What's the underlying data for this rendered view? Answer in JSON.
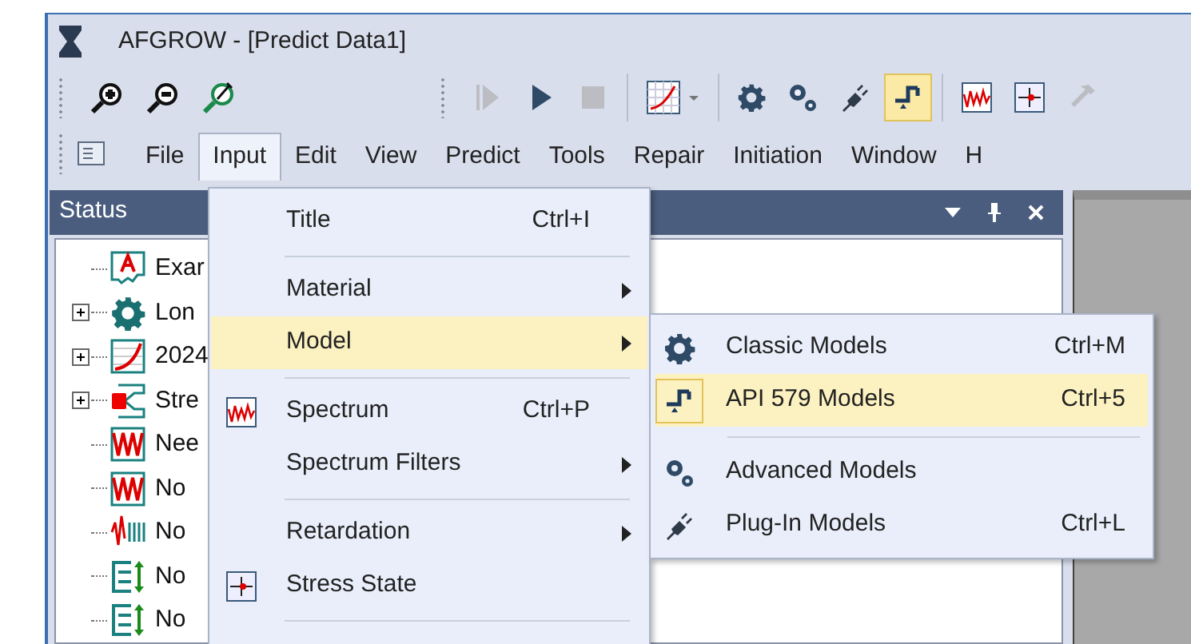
{
  "window": {
    "title": "AFGROW - [Predict Data1]"
  },
  "toolbar": {
    "buttons": [
      {
        "selected": false,
        "disabled": false
      },
      {
        "selected": false,
        "disabled": false
      },
      {
        "selected": false,
        "disabled": false
      },
      {
        "selected": false,
        "disabled": true
      },
      {
        "selected": false,
        "disabled": false
      },
      {
        "selected": false,
        "disabled": true
      },
      {
        "selected": false,
        "disabled": false
      },
      {
        "selected": false,
        "disabled": false
      },
      {
        "selected": false,
        "disabled": false
      },
      {
        "selected": false,
        "disabled": false
      },
      {
        "selected": true,
        "disabled": false
      },
      {
        "selected": false,
        "disabled": false
      },
      {
        "selected": false,
        "disabled": false
      },
      {
        "selected": false,
        "disabled": true
      }
    ]
  },
  "menubar": {
    "items": [
      {
        "label": "File",
        "selected": false
      },
      {
        "label": "Input",
        "selected": true
      },
      {
        "label": "Edit",
        "selected": false
      },
      {
        "label": "View",
        "selected": false
      },
      {
        "label": "Predict",
        "selected": false
      },
      {
        "label": "Tools",
        "selected": false
      },
      {
        "label": "Repair",
        "selected": false
      },
      {
        "label": "Initiation",
        "selected": false
      },
      {
        "label": "Window",
        "selected": false
      },
      {
        "label": "H",
        "selected": false
      }
    ]
  },
  "status_panel": {
    "title": "Status",
    "tree": [
      {
        "label": "Exar",
        "kind": "leaf"
      },
      {
        "label": "Lon",
        "kind": "branch"
      },
      {
        "label": "2024",
        "kind": "branch"
      },
      {
        "label": "Stre",
        "kind": "branch"
      },
      {
        "label": "Nee",
        "kind": "leaf"
      },
      {
        "label": "No",
        "kind": "leaf"
      },
      {
        "label": "No",
        "kind": "leaf"
      },
      {
        "label": "No",
        "kind": "leaf"
      },
      {
        "label": "No",
        "kind": "leaf"
      }
    ]
  },
  "input_menu": {
    "items": [
      {
        "kind": "item",
        "label": "Title",
        "shortcut": "Ctrl+I",
        "submenu": false,
        "selected": false
      },
      {
        "kind": "separator"
      },
      {
        "kind": "item",
        "label": "Material",
        "submenu": true,
        "selected": false
      },
      {
        "kind": "item",
        "label": "Model",
        "submenu": true,
        "selected": true
      },
      {
        "kind": "separator"
      },
      {
        "kind": "item",
        "label": "Spectrum",
        "shortcut": "Ctrl+P",
        "submenu": false,
        "selected": false
      },
      {
        "kind": "item",
        "label": "Spectrum Filters",
        "submenu": true,
        "selected": false
      },
      {
        "kind": "separator"
      },
      {
        "kind": "item",
        "label": "Retardation",
        "submenu": true,
        "selected": false
      },
      {
        "kind": "item",
        "label": "Stress State",
        "submenu": false,
        "selected": false
      },
      {
        "kind": "separator"
      }
    ]
  },
  "model_submenu": {
    "items": [
      {
        "kind": "item",
        "label": "Classic Models",
        "shortcut": "Ctrl+M",
        "selected": false
      },
      {
        "kind": "item",
        "label": "API 579 Models",
        "shortcut": "Ctrl+5",
        "selected": true
      },
      {
        "kind": "separator"
      },
      {
        "kind": "item",
        "label": "Advanced Models",
        "selected": false
      },
      {
        "kind": "item",
        "label": "Plug-In Models",
        "shortcut": "Ctrl+L",
        "selected": false
      }
    ]
  }
}
